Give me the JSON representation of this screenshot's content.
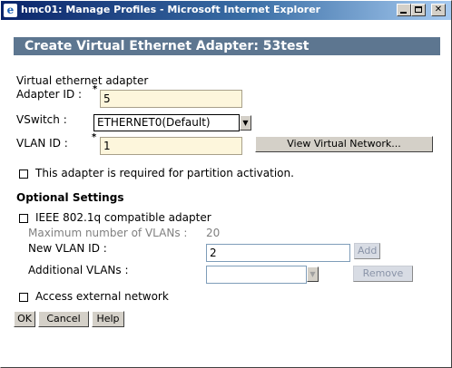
{
  "window": {
    "title": "hmc01: Manage Profiles - Microsoft Internet Explorer"
  },
  "header": {
    "title": "Create Virtual Ethernet Adapter: 53test"
  },
  "form": {
    "section_label": "Virtual ethernet adapter",
    "adapter_id_label": "Adapter ID :",
    "adapter_id_value": "5",
    "vswitch_label": "VSwitch :",
    "vswitch_value": "ETHERNET0(Default)",
    "vlan_id_label": "VLAN ID :",
    "vlan_id_value": "1",
    "required_mark": "*",
    "view_network_button": "View Virtual Network...",
    "required_checkbox_label": "This adapter is required for partition activation."
  },
  "optional": {
    "title": "Optional Settings",
    "ieee_label": "IEEE 802.1q compatible adapter",
    "max_vlans_label": "Maximum number of VLANs :",
    "max_vlans_value": "20",
    "new_vlan_label": "New VLAN ID :",
    "new_vlan_value": "2",
    "add_button": "Add",
    "additional_vlans_label": "Additional VLANs :",
    "additional_vlans_value": "",
    "remove_button": "Remove",
    "access_external_label": "Access external network"
  },
  "buttons": {
    "ok": "OK",
    "cancel": "Cancel",
    "help": "Help"
  },
  "icons": {
    "window_icon": "internet-explorer-icon",
    "dropdown": "triangle-down-icon"
  }
}
